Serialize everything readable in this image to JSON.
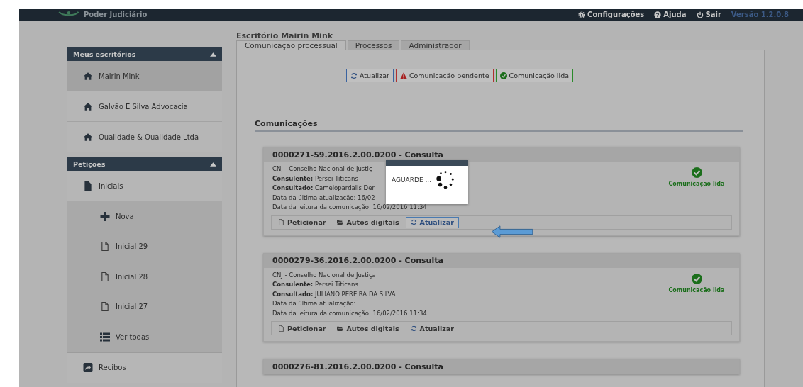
{
  "header": {
    "brand": "Poder Judiciário",
    "links": [
      {
        "label": "Configurações"
      },
      {
        "label": "Ajuda"
      },
      {
        "label": "Sair"
      }
    ],
    "version": "Versão 1.2.0.8"
  },
  "sidebar": [
    {
      "title": "Meus escritórios",
      "expanded": true,
      "items": [
        {
          "label": "Mairin Mink",
          "selected": true
        },
        {
          "label": "Galvão E Silva Advocacia",
          "selected": false
        },
        {
          "label": "Qualidade & Qualidade Ltda",
          "selected": false
        }
      ]
    },
    {
      "title": "Petições",
      "expanded": true,
      "items": [
        {
          "label": "Iniciais",
          "selected": false,
          "children": [
            {
              "label": "Nova"
            },
            {
              "label": "Inicial 29"
            },
            {
              "label": "Inicial 28"
            },
            {
              "label": "Inicial 27"
            },
            {
              "label": "Ver todas"
            }
          ]
        },
        {
          "label": "Recibos",
          "selected": false
        }
      ]
    }
  ],
  "office_title": "Escritório Mairin Mink",
  "tabs": [
    {
      "label": "Comunicação processual",
      "selected": true
    },
    {
      "label": "Processos",
      "selected": false
    },
    {
      "label": "Administrador",
      "selected": false
    }
  ],
  "filters": [
    {
      "label": "Atualizar",
      "kind": "refresh"
    },
    {
      "label": "Comunicação pendente",
      "kind": "pending"
    },
    {
      "label": "Comunicação lida",
      "kind": "read"
    }
  ],
  "section_title": "Comunicações",
  "cards": [
    {
      "title": "0000271-59.2016.2.00.0200 - Consulta",
      "lines": [
        "CNJ - Conselho Nacional de Justiç",
        "**Consulente:** Persei Titicans",
        "**Consultado:** Camelopardalis Der",
        "Data da última atualização: 16/02",
        "Data da leitura da comunicação: 16/02/2016 11:34"
      ],
      "status": {
        "kind": "read",
        "label": "Comunicação lida"
      },
      "actions": [
        {
          "label": "Peticionar",
          "selected": false
        },
        {
          "label": "Autos digitais",
          "selected": false
        },
        {
          "label": "Atualizar",
          "selected": true
        }
      ],
      "loading": "AGUARDE ..."
    },
    {
      "title": "0000279-36.2016.2.00.0200 - Consulta",
      "lines": [
        "CNJ - Conselho Nacional de Justiça",
        "**Consulente:** Persei Titicans",
        "**Consultado:** JULIANO PEREIRA DA SILVA",
        "Data da última atualização:",
        "Data da leitura da comunicação: 16/02/2016 11:34"
      ],
      "status": {
        "kind": "read",
        "label": "Comunicação lida"
      },
      "actions": [
        {
          "label": "Peticionar",
          "selected": false
        },
        {
          "label": "Autos digitais",
          "selected": false
        },
        {
          "label": "Atualizar",
          "selected": false
        }
      ]
    },
    {
      "title": "0000276-81.2016.2.00.0200 - Consulta"
    }
  ]
}
